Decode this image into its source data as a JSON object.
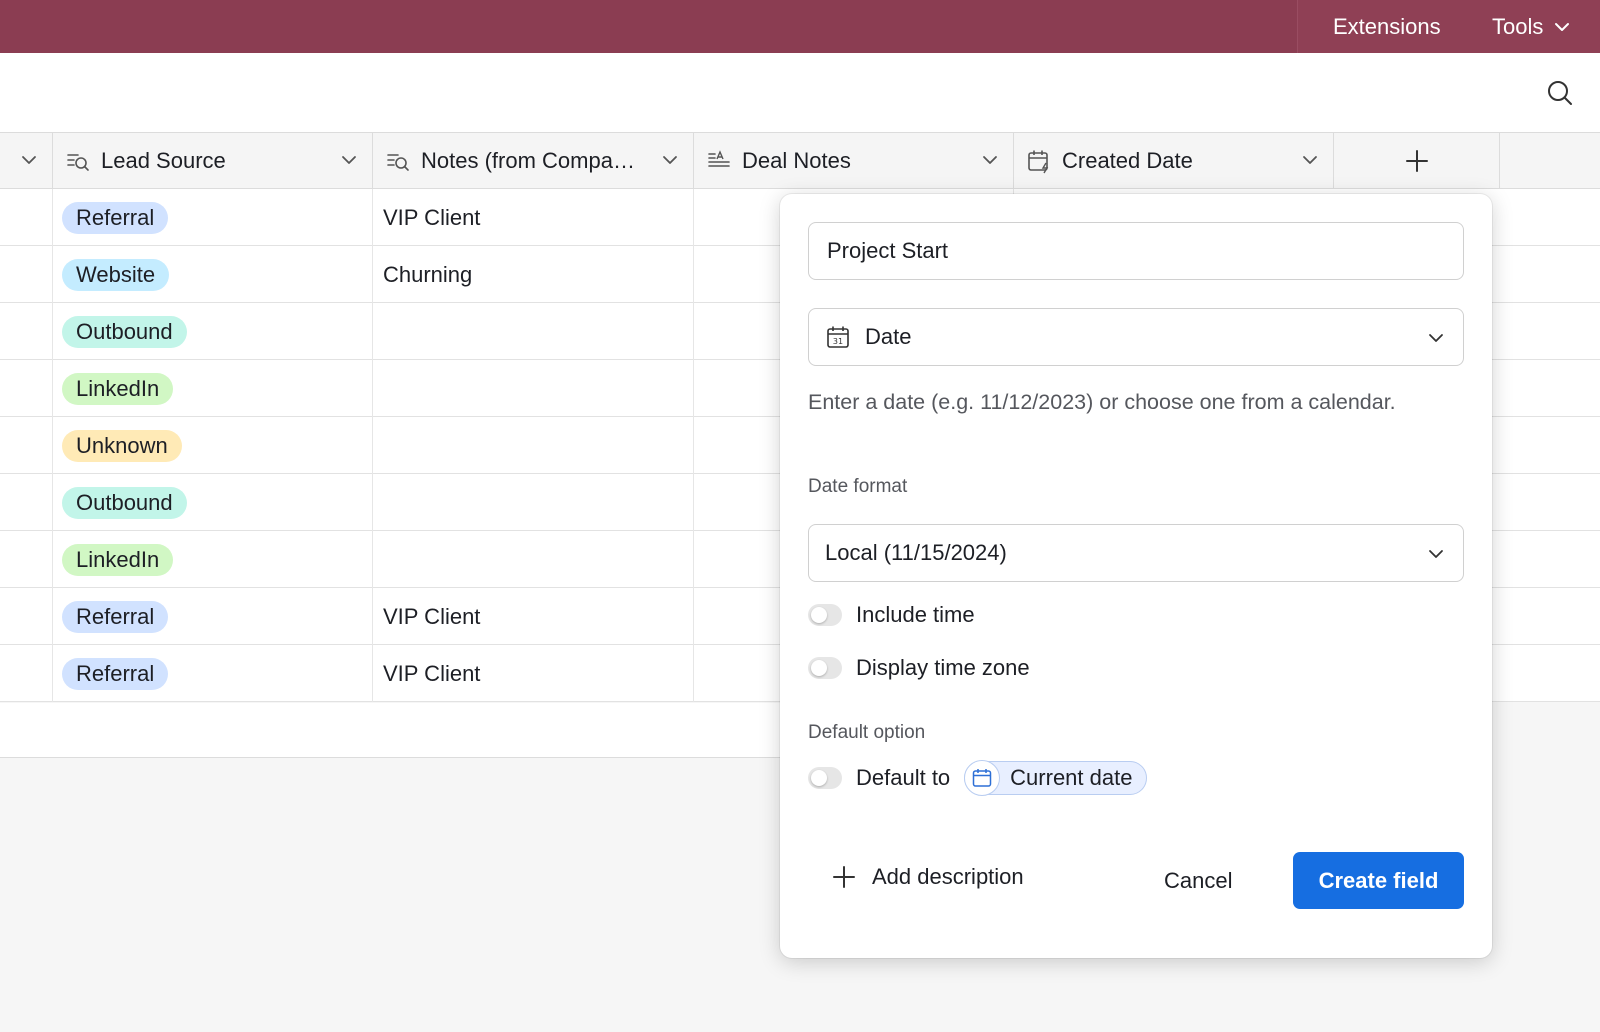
{
  "topbar": {
    "extensions_label": "Extensions",
    "tools_label": "Tools"
  },
  "toolbar": {
    "search_icon": "search-icon"
  },
  "columns": [
    {
      "label": "Lead Source",
      "icon": "lookup-icon"
    },
    {
      "label": "Notes (from Compa…",
      "icon": "lookup-icon"
    },
    {
      "label": "Deal Notes",
      "icon": "long-text-icon"
    },
    {
      "label": "Created Date",
      "icon": "created-date-icon"
    }
  ],
  "rows": [
    {
      "lead_source": "Referral",
      "notes": "VIP Client"
    },
    {
      "lead_source": "Website",
      "notes": "Churning"
    },
    {
      "lead_source": "Outbound",
      "notes": ""
    },
    {
      "lead_source": "LinkedIn",
      "notes": ""
    },
    {
      "lead_source": "Unknown",
      "notes": ""
    },
    {
      "lead_source": "Outbound",
      "notes": ""
    },
    {
      "lead_source": "LinkedIn",
      "notes": ""
    },
    {
      "lead_source": "Referral",
      "notes": "VIP Client"
    },
    {
      "lead_source": "Referral",
      "notes": "VIP Client"
    }
  ],
  "tag_colors": {
    "Referral": "#d1e2ff",
    "Website": "#c4ecff",
    "Outbound": "#c2f5e9",
    "LinkedIn": "#d1f7c4",
    "Unknown": "#ffeab6"
  },
  "popover": {
    "field_name": "Project Start",
    "field_type": "Date",
    "help_text": "Enter a date (e.g. 11/12/2023) or choose one from a calendar.",
    "date_format_label": "Date format",
    "date_format_value": "Local (11/15/2024)",
    "include_time_label": "Include time",
    "display_time_zone_label": "Display time zone",
    "default_option_label": "Default option",
    "default_to_label": "Default to",
    "current_date_label": "Current date",
    "add_description_label": "Add description",
    "cancel_label": "Cancel",
    "create_label": "Create field"
  },
  "colors": {
    "topbar": "#8b3d52",
    "primary_button": "#166ee1"
  }
}
